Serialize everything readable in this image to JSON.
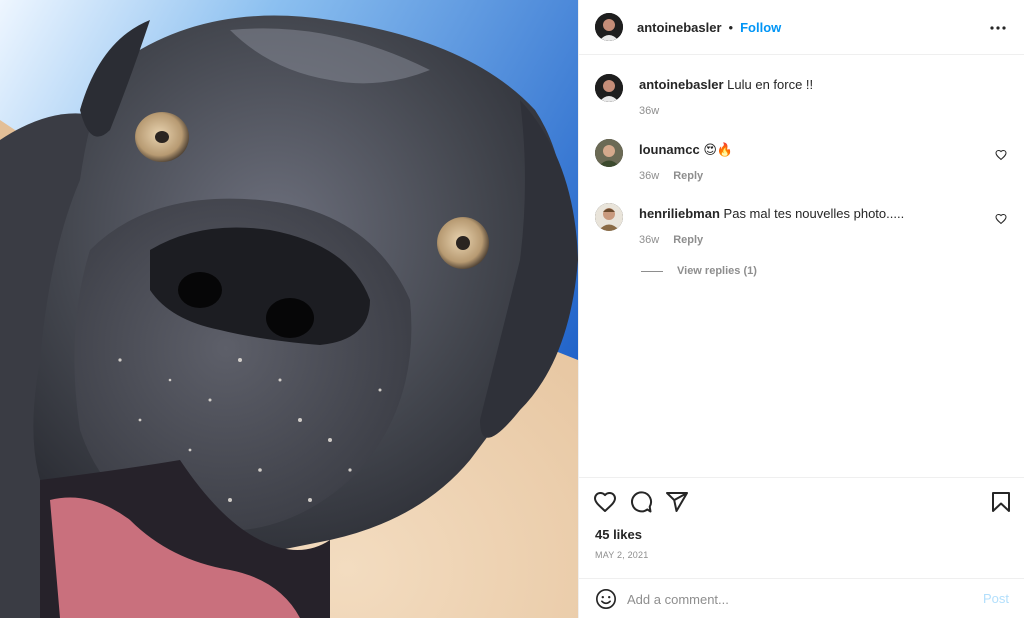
{
  "post": {
    "image_alt_subject": "dog-photo",
    "author": {
      "username": "antoinebasler",
      "follow_label": "Follow",
      "separator": "•"
    },
    "caption": {
      "username": "antoinebasler",
      "text": "Lulu en force !!",
      "time": "36w"
    },
    "comments": [
      {
        "username": "lounamcc",
        "text": "😍🔥",
        "time": "36w",
        "reply_label": "Reply"
      },
      {
        "username": "henriliebman",
        "text": "Pas mal tes nouvelles photo.....",
        "time": "36w",
        "reply_label": "Reply"
      }
    ],
    "view_replies_label": "View replies (1)",
    "likes": "45 likes",
    "date": "MAY 2, 2021"
  },
  "add_comment": {
    "placeholder": "Add a comment...",
    "post_label": "Post"
  },
  "colors": {
    "accent": "#0095f6",
    "post_disabled": "#b2dffc",
    "muted": "#8e8e8e",
    "text": "#262626"
  },
  "icons": {
    "more": "more-horizontal-icon",
    "like": "heart-icon",
    "comment": "comment-icon",
    "share": "send-icon",
    "save": "bookmark-icon",
    "emoji": "emoji-icon",
    "comment_like": "heart-icon"
  }
}
